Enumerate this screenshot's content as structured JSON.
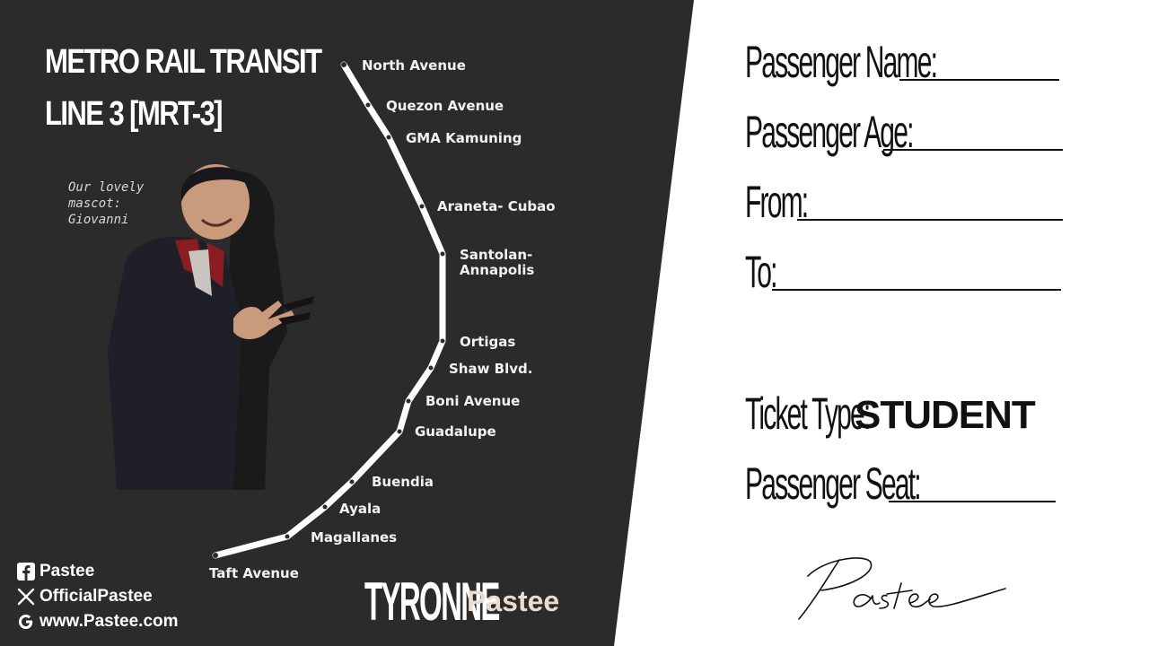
{
  "title": {
    "line1": "METRO RAIL TRANSIT",
    "line2": "LINE 3 [MRT-3]"
  },
  "mascot": {
    "caption": "Our lovely mascot: Giovanni"
  },
  "stations": [
    "North Avenue",
    "Quezon Avenue",
    "GMA Kamuning",
    "Araneta- Cubao",
    "Santolan- Annapolis",
    "Ortigas",
    "Shaw Blvd.",
    "Boni Avenue",
    "Guadalupe",
    "Buendia",
    "Ayala",
    "Magallanes",
    "Taft Avenue"
  ],
  "social": {
    "facebook": "Pastee",
    "x": "OfficialPastee",
    "website": "www.Pastee.com"
  },
  "brand": {
    "name_a": "TYRONNE",
    "name_b": "Pastee"
  },
  "ticket": {
    "passenger_name_label": "Passenger Name:",
    "passenger_age_label": "Passenger Age:",
    "from_label": "From:",
    "to_label": "To:",
    "ticket_type_label": "Ticket Type:",
    "ticket_type_value": "STUDENT",
    "passenger_seat_label": "Passenger Seat:",
    "signature": "Pastee"
  },
  "colors": {
    "panel": "#2b2b2b",
    "text_light": "#ffffff",
    "ink": "#111111",
    "accent_brand": "#e9dcd3"
  }
}
